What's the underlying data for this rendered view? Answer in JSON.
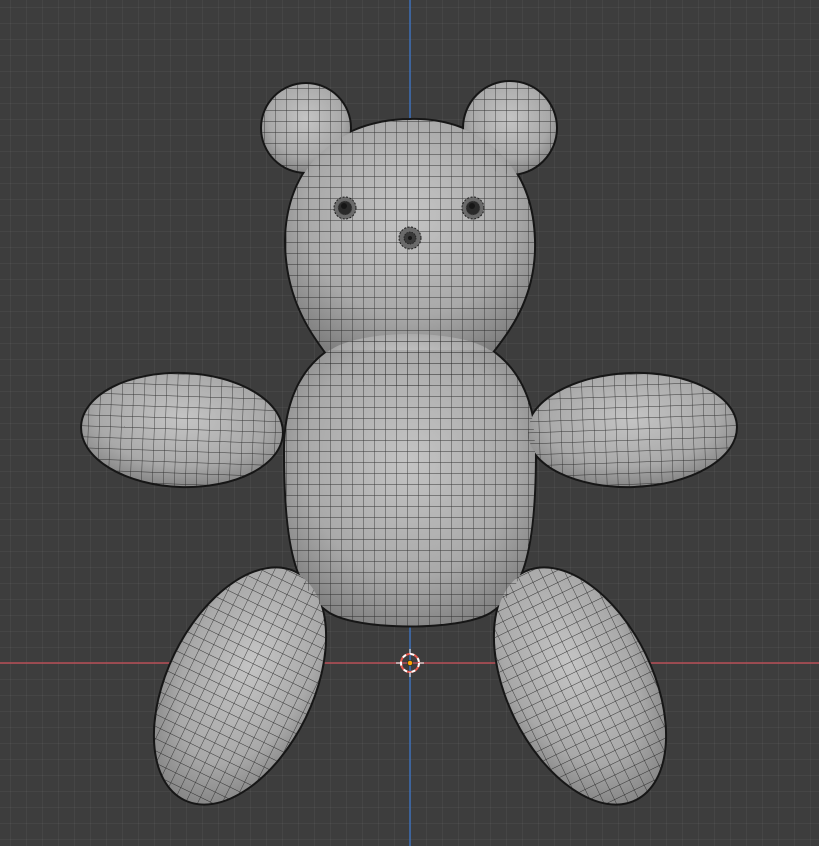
{
  "viewport": {
    "background_color": "#3d3d3d",
    "grid_color": "#474747",
    "x_axis_color": "#b84e57",
    "z_axis_color": "#3d6fb8"
  },
  "model": {
    "shading": "solid",
    "overlay": "wireframe",
    "base_color": "#a9a9a9",
    "wire_color": "#1e1e1e"
  },
  "cursor": {
    "icon": "3d-cursor-icon",
    "ring_color": "#e85a4f",
    "dash_color": "#ffffff",
    "origin_color": "#ffa500"
  }
}
